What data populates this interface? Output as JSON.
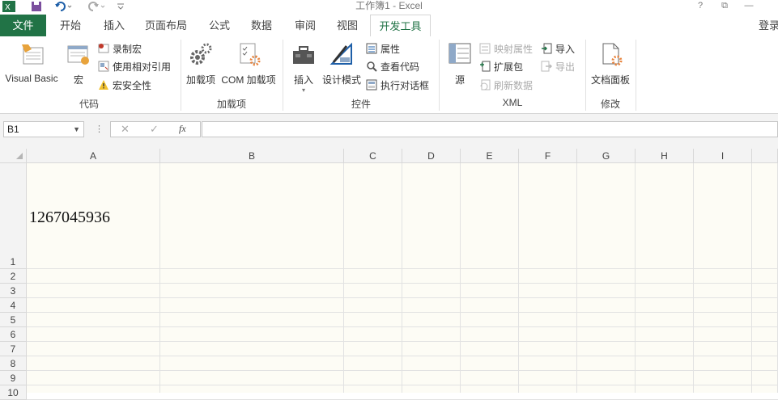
{
  "titlebar": {
    "title": "工作簿1 - Excel",
    "help": "?",
    "restore": "⧉",
    "minimize": "—"
  },
  "tabs": {
    "file": "文件",
    "items": [
      "开始",
      "插入",
      "页面布局",
      "公式",
      "数据",
      "审阅",
      "视图",
      "开发工具"
    ],
    "active": "开发工具",
    "signin": "登录"
  },
  "ribbon": {
    "code": {
      "label": "代码",
      "visual_basic": "Visual Basic",
      "macros": "宏",
      "record_macro": "录制宏",
      "relative_refs": "使用相对引用",
      "macro_security": "宏安全性"
    },
    "addins": {
      "label": "加载项",
      "addins": "加载项",
      "com_addins": "COM 加载项"
    },
    "controls": {
      "label": "控件",
      "insert": "插入",
      "design_mode": "设计模式",
      "properties": "属性",
      "view_code": "查看代码",
      "run_dialog": "执行对话框"
    },
    "xml": {
      "label": "XML",
      "source": "源",
      "map_properties": "映射属性",
      "expansion_packs": "扩展包",
      "refresh_data": "刷新数据",
      "import": "导入",
      "export": "导出"
    },
    "modify": {
      "label": "修改",
      "document_panel": "文档面板"
    }
  },
  "formula_bar": {
    "name_box": "B1",
    "cancel": "✕",
    "enter": "✓",
    "fx": "fx",
    "value": ""
  },
  "sheet": {
    "columns": [
      "A",
      "B",
      "C",
      "D",
      "E",
      "F",
      "G",
      "H",
      "I"
    ],
    "rows": [
      "1",
      "2",
      "3",
      "4",
      "5",
      "6",
      "7",
      "8",
      "9",
      "10"
    ],
    "cell_a1": "1267045936"
  },
  "colors": {
    "excel_green": "#217346",
    "grid_bg": "#fdfcf5"
  }
}
